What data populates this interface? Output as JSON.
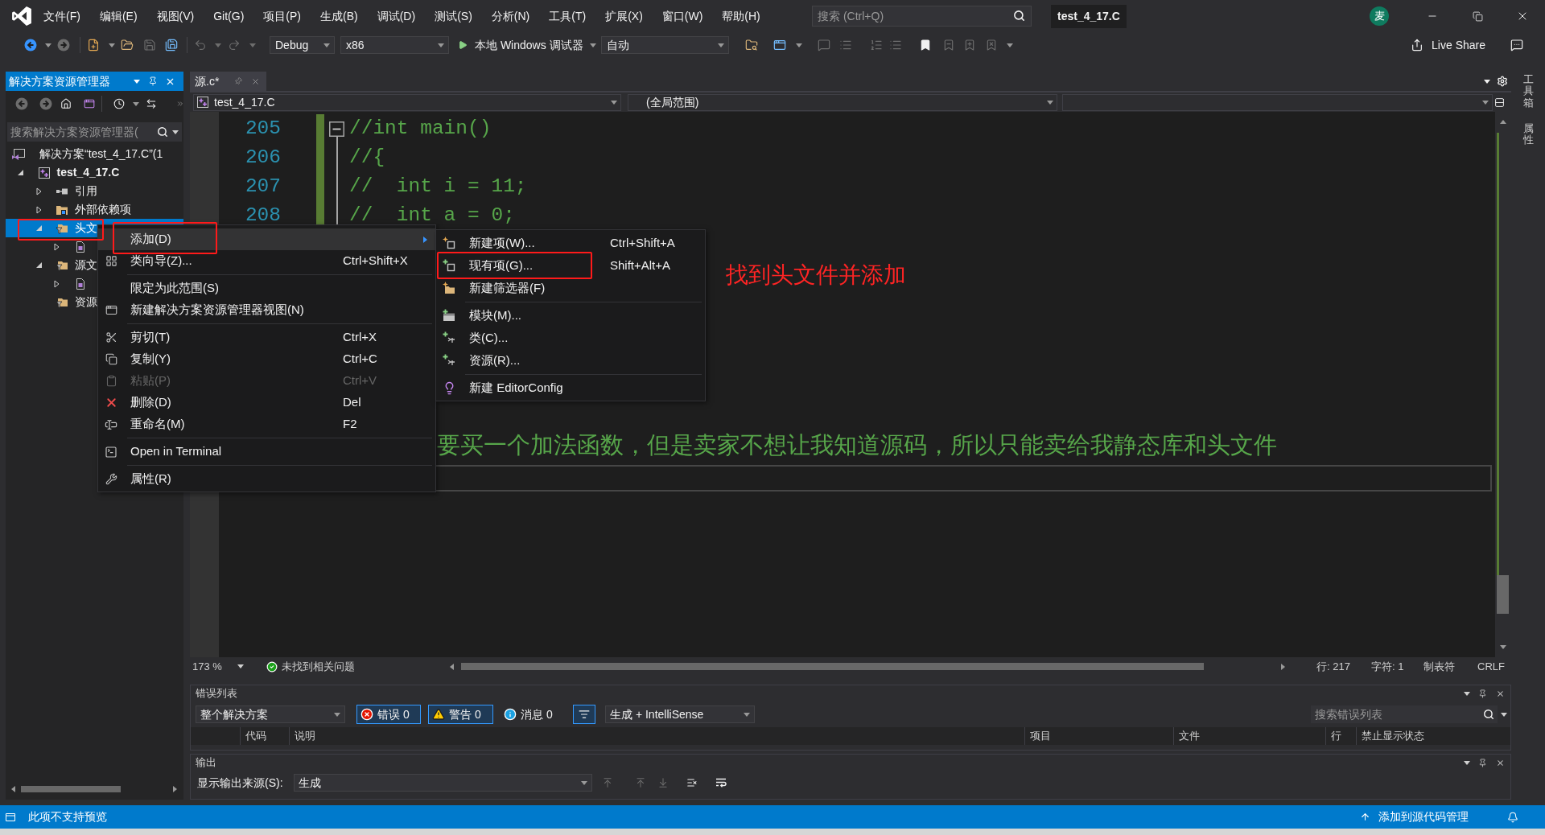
{
  "title_bar": {
    "menu": [
      "文件(F)",
      "编辑(E)",
      "视图(V)",
      "Git(G)",
      "项目(P)",
      "生成(B)",
      "调试(D)",
      "测试(S)",
      "分析(N)",
      "工具(T)",
      "扩展(X)",
      "窗口(W)",
      "帮助(H)"
    ],
    "search": {
      "placeholder": "搜索 (Ctrl+Q)"
    },
    "title": "test_4_17.C",
    "avatar": "麦"
  },
  "toolbar": {
    "configuration": "Debug",
    "platform": "x86",
    "start": "本地 Windows 调试器",
    "start_option": "自动",
    "live_share": "Live Share"
  },
  "solution_explorer": {
    "title": "解决方案资源管理器",
    "search": {
      "placeholder": "搜索解决方案资源管理器("
    },
    "tree": [
      {
        "kind": "solution",
        "label": "解决方案“test_4_17.C”(1",
        "selected": false,
        "children": [
          {
            "kind": "project",
            "label": "test_4_17.C",
            "expanded": true,
            "selected": false,
            "children": [
              {
                "kind": "references",
                "label": "引用",
                "expanded": false,
                "selected": false
              },
              {
                "kind": "external",
                "label": "外部依赖项",
                "expanded": false,
                "selected": false
              },
              {
                "kind": "filter",
                "label": "头文",
                "expanded": true,
                "selected": true,
                "children": [
                  {
                    "kind": "file",
                    "expanded": false,
                    "selected": false
                  }
                ]
              },
              {
                "kind": "filter",
                "label": "源文",
                "expanded": true,
                "selected": false,
                "children": [
                  {
                    "kind": "file",
                    "expanded": false,
                    "selected": false
                  }
                ]
              },
              {
                "kind": "filter",
                "label": "资源",
                "selected": false
              }
            ]
          }
        ]
      }
    ]
  },
  "editor": {
    "tab": "源.c*",
    "navigation": {
      "project": "test_4_17.C",
      "scope": "(全局范围)"
    },
    "lines": [
      {
        "number": "205",
        "text": "//int main()",
        "foldable": true,
        "changed": true
      },
      {
        "number": "206",
        "text": "//{",
        "foldable": false,
        "changed": true
      },
      {
        "number": "207",
        "text": "//  int i = 11;",
        "foldable": false,
        "changed": true
      },
      {
        "number": "208",
        "text": "//  int a = 0;",
        "foldable": false,
        "changed": true
      }
    ],
    "partly_covered_line": "要买一个加法函数，但是卖家不想让我知道源码，所以只能卖给我静态库和头文件",
    "status": {
      "zoom": "173 %",
      "issues": "未找到相关问题",
      "line": "行: 217",
      "column": "字符: 1",
      "indentation": "制表符",
      "line_ending": "CRLF"
    }
  },
  "context_menu": {
    "items": [
      {
        "kind": "item",
        "label": "添加(D)",
        "submenu": true,
        "selected": true,
        "disabled": false
      },
      {
        "kind": "item",
        "label": "类向导(Z)...",
        "shortcut": "Ctrl+Shift+X",
        "submenu": false,
        "selected": false,
        "disabled": false
      },
      {
        "kind": "separator"
      },
      {
        "kind": "item",
        "label": "限定为此范围(S)",
        "submenu": false,
        "selected": false,
        "disabled": false
      },
      {
        "kind": "item",
        "label": "新建解决方案资源管理器视图(N)",
        "submenu": false,
        "selected": false,
        "disabled": false
      },
      {
        "kind": "separator"
      },
      {
        "kind": "item",
        "label": "剪切(T)",
        "shortcut": "Ctrl+X",
        "submenu": false,
        "selected": false,
        "disabled": false
      },
      {
        "kind": "item",
        "label": "复制(Y)",
        "shortcut": "Ctrl+C",
        "submenu": false,
        "selected": false,
        "disabled": false
      },
      {
        "kind": "item",
        "label": "粘贴(P)",
        "shortcut": "Ctrl+V",
        "submenu": false,
        "selected": false,
        "disabled": true
      },
      {
        "kind": "item",
        "label": "删除(D)",
        "shortcut": "Del",
        "submenu": false,
        "selected": false,
        "disabled": false
      },
      {
        "kind": "item",
        "label": "重命名(M)",
        "shortcut": "F2",
        "submenu": false,
        "selected": false,
        "disabled": false
      },
      {
        "kind": "separator"
      },
      {
        "kind": "item",
        "label": "Open in Terminal",
        "submenu": false,
        "selected": false,
        "disabled": false
      },
      {
        "kind": "separator"
      },
      {
        "kind": "item",
        "label": "属性(R)",
        "submenu": false,
        "selected": false,
        "disabled": false
      }
    ]
  },
  "submenu": {
    "items": [
      {
        "kind": "item",
        "label": "新建项(W)...",
        "shortcut": "Ctrl+Shift+A"
      },
      {
        "kind": "item",
        "label": "现有项(G)...",
        "shortcut": "Shift+Alt+A"
      },
      {
        "kind": "item",
        "label": "新建筛选器(F)"
      },
      {
        "kind": "separator"
      },
      {
        "kind": "item",
        "label": "模块(M)..."
      },
      {
        "kind": "item",
        "label": "类(C)..."
      },
      {
        "kind": "item",
        "label": "资源(R)..."
      },
      {
        "kind": "separator"
      },
      {
        "kind": "item",
        "label": "新建 EditorConfig"
      }
    ]
  },
  "annotation": "找到头文件并添加",
  "error_list": {
    "title": "错误列表",
    "scope": "整个解决方案",
    "filters": [
      {
        "label": "错误 0",
        "on": true
      },
      {
        "label": "警告 0",
        "on": true
      },
      {
        "label": "消息 0",
        "on": false
      }
    ],
    "filter_button": {
      "on": true
    },
    "source": "生成 + IntelliSense",
    "search": {
      "placeholder": "搜索错误列表"
    },
    "columns": [
      "代码",
      "说明",
      "项目",
      "文件",
      "行",
      "禁止显示状态"
    ]
  },
  "output": {
    "title": "输出",
    "source_label": "显示输出来源(S):",
    "source": "生成"
  },
  "side_tabs": [
    "工具箱",
    "属性"
  ],
  "status_bar": {
    "message": "此项不支持预览",
    "source_control": "添加到源代码管理"
  }
}
